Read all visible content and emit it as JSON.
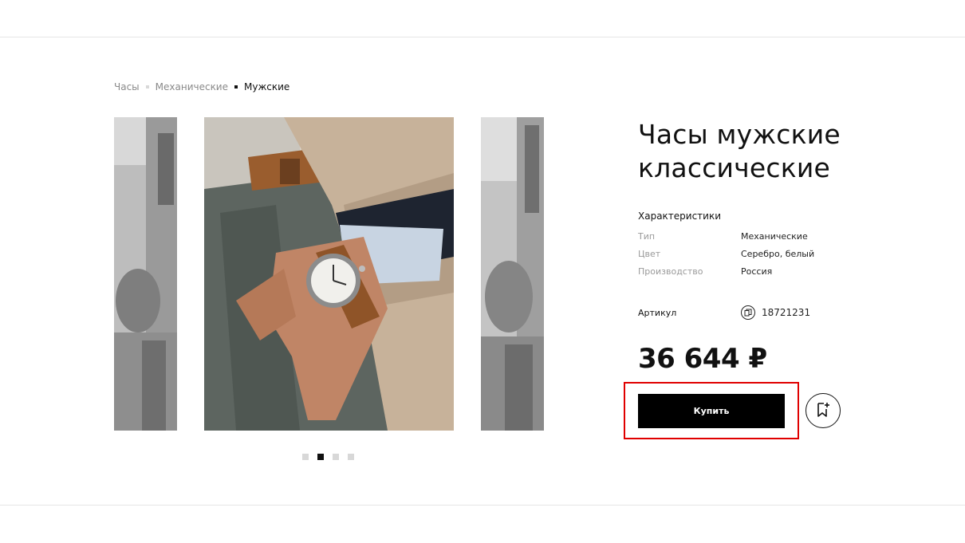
{
  "breadcrumb": {
    "items": [
      "Часы",
      "Механические",
      "Мужские"
    ]
  },
  "gallery": {
    "slide_count": 4,
    "active_index": 1
  },
  "product": {
    "title": "Часы мужские классические",
    "specs_heading": "Характеристики",
    "specs": [
      {
        "label": "Тип",
        "value": "Механические"
      },
      {
        "label": "Цвет",
        "value": "Серебро, белый"
      },
      {
        "label": "Производство",
        "value": "Россия"
      }
    ],
    "sku_label": "Артикул",
    "sku_value": "18721231",
    "price": "36 644 ₽",
    "buy_label": "Купить"
  },
  "colors": {
    "accent": "#000000",
    "highlight": "#e00000"
  }
}
